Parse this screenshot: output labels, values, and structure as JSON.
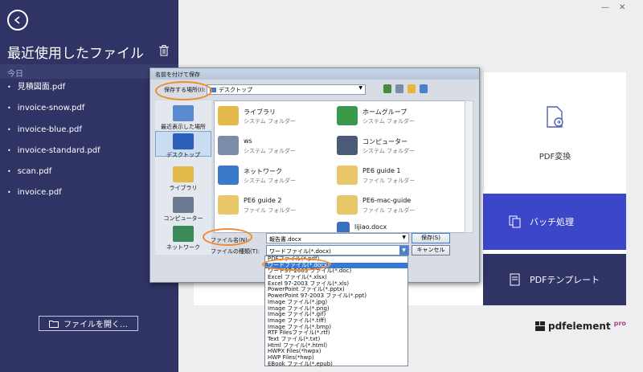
{
  "sidebar": {
    "title": "最近使用したファイル",
    "section": "今日",
    "files": [
      "見積図面.pdf",
      "invoice-snow.pdf",
      "invoice-blue.pdf",
      "invoice-standard.pdf",
      "scan.pdf",
      "invoice.pdf"
    ],
    "open_button": "ファイルを開く…"
  },
  "window_controls": {
    "minimize": "—",
    "close": "✕"
  },
  "cards": {
    "convert": "PDF変換",
    "batch": "バッチ処理",
    "template": "PDFテンプレート"
  },
  "brand": {
    "name": "pdfelement",
    "badge": "pro"
  },
  "dialog": {
    "title": "名前を付けて保存",
    "location_label": "保存する場所(I):",
    "location_value": "デスクトップ",
    "places": [
      "最近表示した場所",
      "デスクトップ",
      "ライブラリ",
      "コンピューター",
      "ネットワーク"
    ],
    "items": [
      {
        "name": "ライブラリ",
        "sub": "システム フォルダー",
        "icon": "library-icon"
      },
      {
        "name": "ホームグループ",
        "sub": "システム フォルダー",
        "icon": "homegroup-icon"
      },
      {
        "name": "ws",
        "sub": "システム フォルダー",
        "icon": "user-icon"
      },
      {
        "name": "コンピューター",
        "sub": "システム フォルダー",
        "icon": "computer-icon"
      },
      {
        "name": "ネットワーク",
        "sub": "システム フォルダー",
        "icon": "network-icon"
      },
      {
        "name": "PE6 guide 1",
        "sub": "ファイル フォルダー",
        "icon": "folder-icon"
      },
      {
        "name": "PE6 guide 2",
        "sub": "ファイル フォルダー",
        "icon": "folder-icon"
      },
      {
        "name": "PE6-mac-guide",
        "sub": "ファイル フォルダー",
        "icon": "folder-icon"
      },
      {
        "name": "lijiao.docx",
        "sub": "",
        "icon": "docx-icon"
      }
    ],
    "filename_label": "ファイル名(N):",
    "filename_value": "報告書.docx",
    "filetype_label": "ファイルの種類(T):",
    "filetype_value": "ワードファイル(*.docx)",
    "save_button": "保存(S)",
    "cancel_button": "キャンセル"
  },
  "dropdown_options": [
    "PDFファイル(*.pdf)",
    "ワードファイル(*.docx)",
    "ワード97-2003 ファイル(*.doc)",
    "Excel ファイル(*.xlsx)",
    "Excel 97-2003 ファイル(*.xls)",
    "PowerPoint ファイル(*.pptx)",
    "PowerPoint 97-2003 ファイル(*.ppt)",
    "Image ファイル(*.jpg)",
    "Image ファイル(*.png)",
    "Image ファイル(*.gif)",
    "Image ファイル(*.tiff)",
    "Image ファイル(*.bmp)",
    "RTF Filesファイル(*.rtf)",
    "Text ファイル(*.txt)",
    "Html ファイル(*.html)",
    "HWPX Files(*hwpx)",
    "HWP Files(*hwp)",
    "EBook ファイル(*.epub)"
  ],
  "dropdown_selected_index": 1,
  "colors": {
    "sidebar": "#2f3465",
    "batch": "#3c46c8",
    "highlight": "#ef8a2d",
    "selection": "#3379d6"
  }
}
